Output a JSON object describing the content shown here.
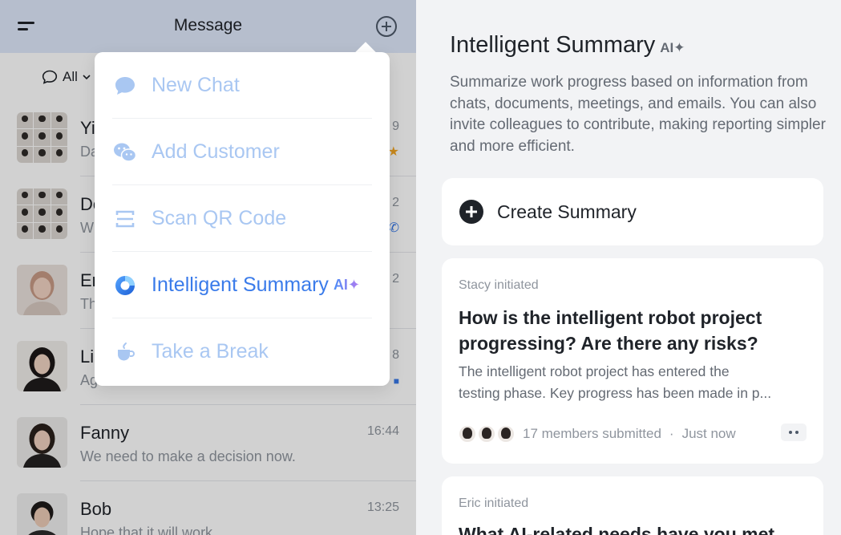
{
  "app": {
    "topbar_title": "Message",
    "filter_label": "All",
    "chats": [
      {
        "name": "Yi",
        "preview": "Da",
        "time": "9",
        "badge": "★",
        "avatar": "group"
      },
      {
        "name": "Do",
        "preview": "W",
        "time": "2",
        "badge": "✆",
        "avatar": "group"
      },
      {
        "name": "Er",
        "preview": "Th",
        "time": "2",
        "badge": "",
        "avatar": "person"
      },
      {
        "name": "Li",
        "preview": "Ag",
        "time": "8",
        "badge": "■",
        "avatar": "person"
      },
      {
        "name": "Fanny",
        "preview": "We need to make a decision now.",
        "time": "16:44",
        "badge": "",
        "avatar": "person"
      },
      {
        "name": "Bob",
        "preview": "Hope that it will work",
        "time": "13:25",
        "badge": "",
        "avatar": "person"
      }
    ],
    "menu": [
      {
        "label": "New Chat",
        "icon": "chat-bubble-icon"
      },
      {
        "label": "Add Customer",
        "icon": "wechat-icon"
      },
      {
        "label": "Scan QR Code",
        "icon": "scan-icon"
      },
      {
        "label": "Intelligent Summary",
        "icon": "summary-icon",
        "ai_tag": "AI✦"
      },
      {
        "label": "Take a Break",
        "icon": "coffee-icon"
      }
    ]
  },
  "summary_panel": {
    "title": "Intelligent Summary",
    "ai_tag": "AI✦",
    "description": "Summarize work progress based on information from chats, documents, meetings, and emails. You can also invite colleagues to contribute, making reporting simpler and more efficient.",
    "create_label": "Create Summary",
    "cards": [
      {
        "initiator": "Stacy initiated",
        "title": "How is the intelligent robot project progressing? Are there any risks?",
        "body_line1": "The intelligent robot project has entered the",
        "body_line2": "testing phase. Key progress has been made in p...",
        "members": "17 members submitted",
        "dot": "·",
        "time": "Just now"
      },
      {
        "initiator": "Eric initiated",
        "title": "What AI-related needs have you met"
      }
    ]
  },
  "colors": {
    "topbar_bg": "#dfe8fb",
    "menu_active": "#3a7bea",
    "menu_inactive": "#a9c7f2",
    "accent_ai_start": "#4c8df6",
    "accent_ai_end": "#b37bf0"
  }
}
